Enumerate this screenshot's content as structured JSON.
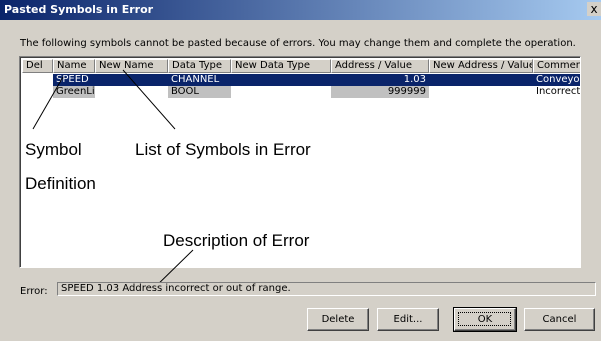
{
  "window": {
    "title": "Pasted Symbols in Error",
    "close_glyph": "x"
  },
  "instructions": "The following symbols cannot be pasted because of errors. You may change them and complete the operation.",
  "table": {
    "columns": [
      "Del",
      "Name",
      "New Name",
      "Data Type",
      "New Data Type",
      "Address / Value",
      "New Address / Value",
      "Comment"
    ],
    "rows": [
      {
        "del": "",
        "name": "SPEED",
        "new_name": "",
        "data_type": "CHANNEL",
        "new_data_type": "",
        "address": "1.03",
        "new_address": "",
        "comment": "Conveyor Sp",
        "selected": true
      },
      {
        "del": "",
        "name": "GreenLi",
        "new_name": "",
        "data_type": "BOOL",
        "new_data_type": "",
        "address": "999999",
        "new_address": "",
        "comment": "Incorrect Act",
        "selected": false
      }
    ]
  },
  "annotations": {
    "symbol_line1": "Symbol",
    "symbol_line2": "Definition",
    "list": "List of Symbols in Error",
    "description": "Description of Error"
  },
  "error": {
    "label": "Error:",
    "text": "SPEED 1.03 Address incorrect or out of range."
  },
  "buttons": {
    "delete": "Delete",
    "edit": "Edit...",
    "ok": "OK",
    "cancel": "Cancel"
  }
}
